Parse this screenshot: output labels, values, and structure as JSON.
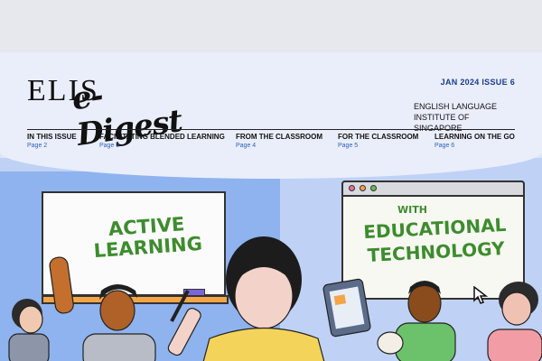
{
  "masthead": {
    "logo_main": "ELIS",
    "logo_script": "e-Digest",
    "issue": "JAN 2024 ISSUE 6",
    "institute_line1": "ENGLISH LANGUAGE",
    "institute_line2": "INSTITUTE OF SINGAPORE"
  },
  "nav": [
    {
      "title": "IN THIS ISSUE",
      "page": "Page 2"
    },
    {
      "title": "FACILITATING BLENDED LEARNING",
      "page": "Page 3"
    },
    {
      "title": "FROM THE CLASSROOM",
      "page": "Page 4"
    },
    {
      "title": "FOR THE CLASSROOM",
      "page": "Page 5"
    },
    {
      "title": "LEARNING ON THE GO",
      "page": "Page 6"
    }
  ],
  "illustration": {
    "left_board_line1": "ACTIVE",
    "left_board_line2": "LEARNING",
    "right_board_small": "WITH",
    "right_board_line1": "EDUCATIONAL",
    "right_board_line2": "TECHNOLOGY"
  },
  "colors": {
    "accent_blue": "#1b3c8f",
    "link_blue": "#2e5fbf",
    "board_green": "#3d8c2f",
    "hero_blue": "#8fb3ef"
  }
}
